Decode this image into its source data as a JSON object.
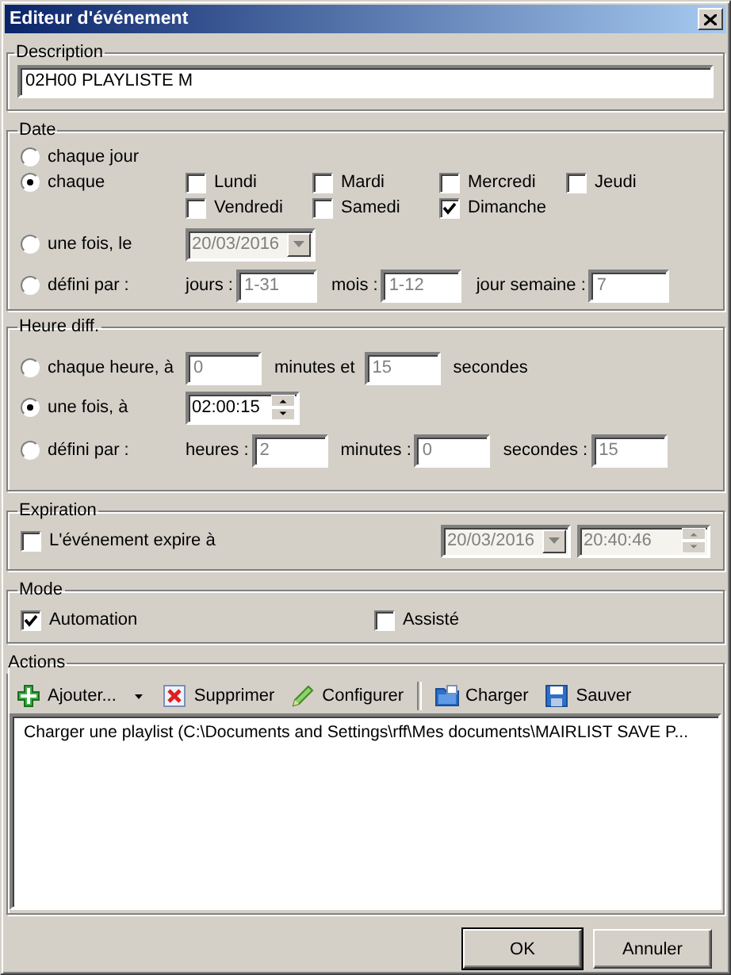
{
  "window": {
    "title": "Editeur d'événement"
  },
  "description": {
    "title": "Description",
    "value": "02H00 PLAYLISTE M"
  },
  "date": {
    "title": "Date",
    "options": [
      {
        "kind": "plain",
        "label": "chaque jour",
        "selected": false
      },
      {
        "kind": "days",
        "label": "chaque",
        "selected": true,
        "days": [
          {
            "label": "Lundi",
            "checked": false
          },
          {
            "label": "Mardi",
            "checked": false
          },
          {
            "label": "Mercredi",
            "checked": false
          },
          {
            "label": "Jeudi",
            "checked": false
          },
          {
            "label": "Vendredi",
            "checked": false
          },
          {
            "label": "Samedi",
            "checked": false
          },
          {
            "label": "Dimanche",
            "checked": true
          }
        ]
      },
      {
        "kind": "date",
        "label": "une fois, le",
        "selected": false,
        "value": "20/03/2016"
      },
      {
        "kind": "fields",
        "label": "défini par :",
        "selected": false,
        "fields": [
          {
            "label": "jours :",
            "value": "1-31"
          },
          {
            "label": "mois :",
            "value": "1-12"
          },
          {
            "label": "jour semaine :",
            "value": "7"
          }
        ]
      }
    ]
  },
  "time": {
    "title": "Heure diff.",
    "options": [
      {
        "kind": "fields",
        "label": "chaque heure, à",
        "selected": false,
        "fields": [
          {
            "value": "0",
            "suffix": "minutes et"
          },
          {
            "value": "15",
            "suffix": "secondes"
          }
        ]
      },
      {
        "kind": "time",
        "label": "une fois, à",
        "selected": true,
        "value": "02:00:15"
      },
      {
        "kind": "fields",
        "label": "défini par :",
        "selected": false,
        "fields": [
          {
            "label": "heures :",
            "value": "2"
          },
          {
            "label": "minutes :",
            "value": "0"
          },
          {
            "label": "secondes :",
            "value": "15"
          }
        ]
      }
    ]
  },
  "expiration": {
    "title": "Expiration",
    "label": "L'événement expire à",
    "checked": false,
    "date": "20/03/2016",
    "time": "20:40:46"
  },
  "mode": {
    "title": "Mode",
    "options": [
      {
        "label": "Automation",
        "checked": true
      },
      {
        "label": "Assisté",
        "checked": false
      }
    ]
  },
  "actions": {
    "title": "Actions",
    "toolbar": [
      [
        {
          "label": "Ajouter...",
          "dropdown": true
        },
        {
          "label": "Supprimer",
          "dropdown": false
        },
        {
          "label": "Configurer",
          "dropdown": false
        }
      ],
      [
        {
          "label": "Charger",
          "dropdown": false
        },
        {
          "label": "Sauver",
          "dropdown": false
        }
      ]
    ],
    "items": [
      "Charger une playlist (C:\\Documents and Settings\\rff\\Mes documents\\MAIRLIST SAVE P..."
    ]
  },
  "buttons": [
    {
      "label": "OK",
      "default": true
    },
    {
      "label": "Annuler",
      "default": false
    }
  ]
}
